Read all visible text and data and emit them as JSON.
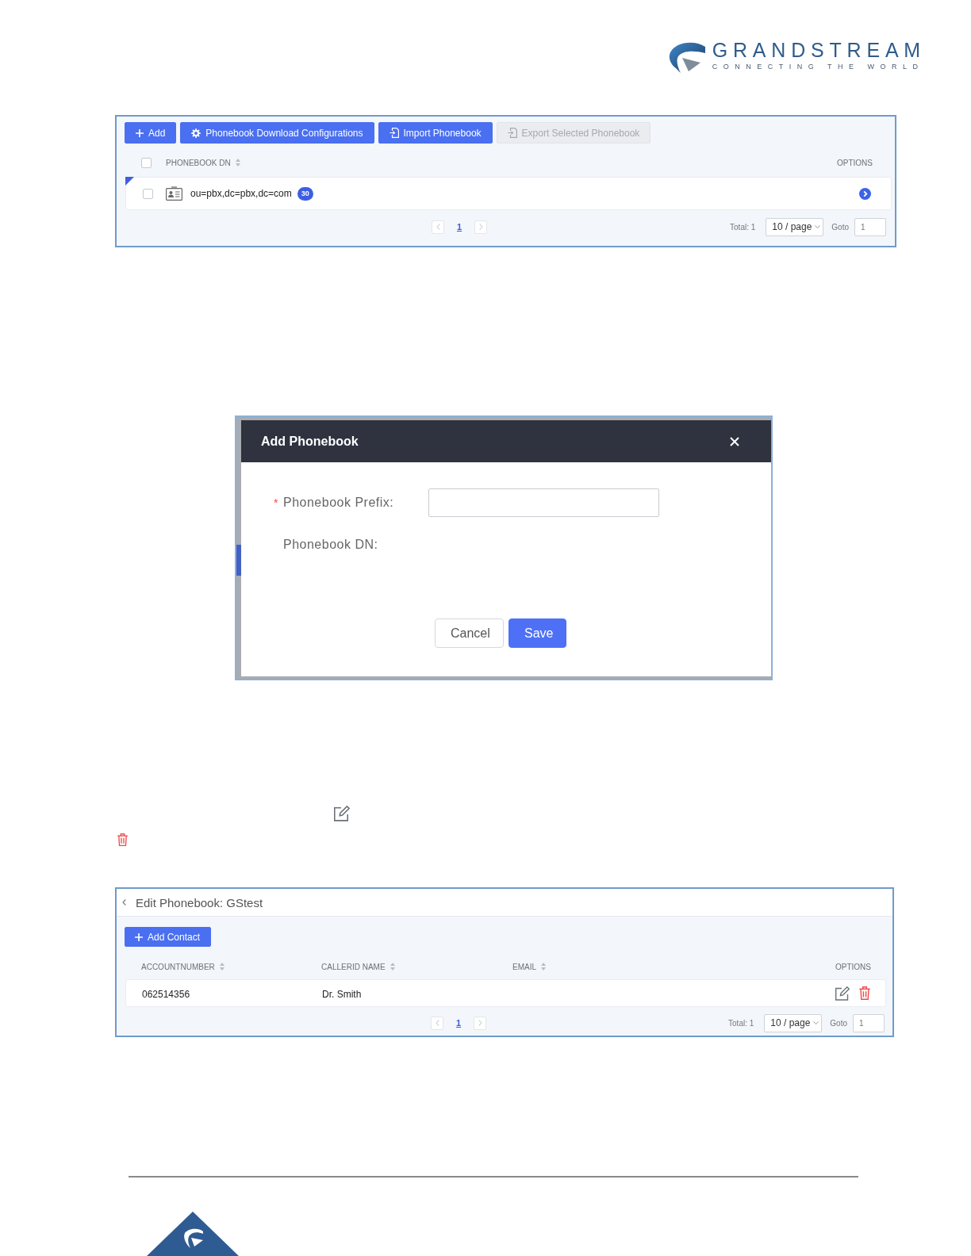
{
  "logo": {
    "name": "GRANDSTREAM",
    "tagline": "CONNECTING THE WORLD"
  },
  "phonebook_list": {
    "toolbar": [
      {
        "label": "Add",
        "disabled": false
      },
      {
        "label": "Phonebook Download Configurations",
        "disabled": false
      },
      {
        "label": "Import Phonebook",
        "disabled": false
      },
      {
        "label": "Export Selected Phonebook",
        "disabled": true
      }
    ],
    "select_all": {
      "checked": false
    },
    "columns": [
      {
        "label": "PHONEBOOK DN",
        "sortable": true
      },
      {
        "label": "OPTIONS",
        "sortable": false
      }
    ],
    "rows": [
      {
        "checked": false,
        "corner_mark": true,
        "dn": "ou=pbx,dc=pbx,dc=com",
        "count": "30"
      }
    ],
    "pagination": {
      "prev_disabled": true,
      "pages": [
        {
          "label": "1",
          "selected": true
        }
      ],
      "next_disabled": true,
      "total": "Total: 1",
      "page_size": "10 / page",
      "goto_label": "Goto",
      "goto_value": "1"
    }
  },
  "add_phonebook_dialog": {
    "title": "Add Phonebook",
    "fields": [
      {
        "kind": "input",
        "required_mark": "*",
        "label": "Phonebook Prefix:"
      },
      {
        "kind": "text",
        "label": "Phonebook DN:"
      }
    ],
    "buttons": [
      {
        "label": "Cancel",
        "kind": "default"
      },
      {
        "label": "Save",
        "kind": "primary"
      }
    ]
  },
  "edit_phonebook": {
    "title": "Edit Phonebook: GStest",
    "toolbar": [
      {
        "label": "Add Contact",
        "disabled": false
      }
    ],
    "columns": [
      {
        "label": "ACCOUNTNUMBER",
        "sortable": true
      },
      {
        "label": "CALLERID NAME",
        "sortable": true
      },
      {
        "label": "EMAIL",
        "sortable": true
      },
      {
        "label": "OPTIONS",
        "sortable": false
      }
    ],
    "rows": [
      {
        "account_number": "062514356",
        "callerid_name": "Dr. Smith"
      }
    ],
    "pagination": {
      "prev_disabled": true,
      "pages": [
        {
          "label": "1",
          "selected": true
        }
      ],
      "next_disabled": true,
      "total": "Total: 1",
      "page_size": "10 / page",
      "goto_label": "Goto",
      "goto_value": "1"
    }
  }
}
